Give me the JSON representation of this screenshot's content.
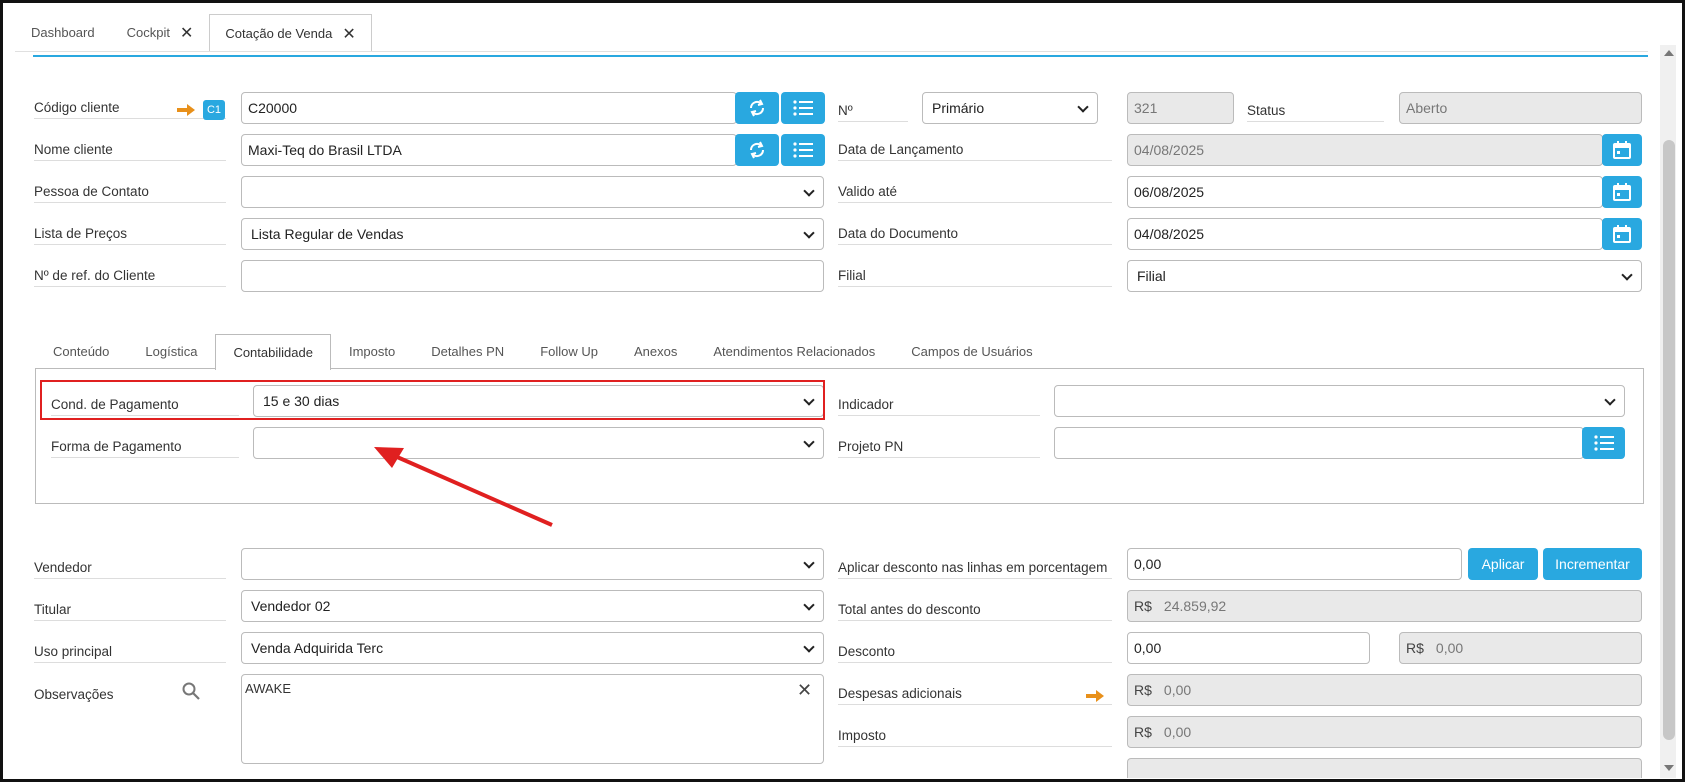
{
  "tabs": [
    {
      "label": "Dashboard"
    },
    {
      "label": "Cockpit",
      "close": "✕"
    },
    {
      "label": "Cotação de Venda",
      "close": "✕",
      "active": true
    }
  ],
  "header": {
    "codigo_cliente": {
      "label": "Código cliente",
      "badge": "C1",
      "value": "C20000"
    },
    "nome_cliente": {
      "label": "Nome cliente",
      "value": "Maxi-Teq do Brasil LTDA"
    },
    "pessoa_contato": {
      "label": "Pessoa de Contato",
      "value": ""
    },
    "lista_precos": {
      "label": "Lista de Preços",
      "value": "Lista Regular de Vendas"
    },
    "ref_cliente": {
      "label": "Nº de ref. do Cliente",
      "value": ""
    },
    "numero": {
      "label": "Nº",
      "series": "Primário",
      "value": "321"
    },
    "status": {
      "label": "Status",
      "value": "Aberto"
    },
    "data_lancamento": {
      "label": "Data de Lançamento",
      "value": "04/08/2025"
    },
    "valido_ate": {
      "label": "Valido até",
      "value": "06/08/2025"
    },
    "data_documento": {
      "label": "Data do Documento",
      "value": "04/08/2025"
    },
    "filial": {
      "label": "Filial",
      "value": "Filial"
    }
  },
  "inner_tabs": [
    {
      "label": "Conteúdo"
    },
    {
      "label": "Logística"
    },
    {
      "label": "Contabilidade",
      "active": true
    },
    {
      "label": "Imposto"
    },
    {
      "label": "Detalhes PN"
    },
    {
      "label": "Follow Up"
    },
    {
      "label": "Anexos"
    },
    {
      "label": "Atendimentos Relacionados"
    },
    {
      "label": "Campos de Usuários"
    }
  ],
  "contabilidade": {
    "cond_pagamento": {
      "label": "Cond. de Pagamento",
      "value": "15 e 30 dias"
    },
    "forma_pagamento": {
      "label": "Forma de Pagamento",
      "value": ""
    },
    "indicador": {
      "label": "Indicador",
      "value": ""
    },
    "projeto_pn": {
      "label": "Projeto PN",
      "value": ""
    }
  },
  "footer": {
    "vendedor": {
      "label": "Vendedor",
      "value": ""
    },
    "titular": {
      "label": "Titular",
      "value": "Vendedor 02"
    },
    "uso_principal": {
      "label": "Uso principal",
      "value": "Venda Adquirida Terc"
    },
    "observacoes": {
      "label": "Observações",
      "value": "AWAKE"
    },
    "aplicar_desconto": {
      "label": "Aplicar desconto nas linhas em porcentagem",
      "value": "0,00",
      "apply_label": "Aplicar",
      "increment_label": "Incrementar"
    },
    "total_antes": {
      "label": "Total antes do desconto",
      "currency": "R$",
      "value": "24.859,92"
    },
    "desconto": {
      "label": "Desconto",
      "value": "0,00",
      "currency": "R$",
      "amount": "0,00"
    },
    "despesas": {
      "label": "Despesas adicionais",
      "currency": "R$",
      "value": "0,00"
    },
    "imposto": {
      "label": "Imposto",
      "currency": "R$",
      "value": "0,00"
    }
  },
  "colors": {
    "accent": "#29a8e0",
    "highlight": "#e02020",
    "arrow": "#e8901a"
  }
}
